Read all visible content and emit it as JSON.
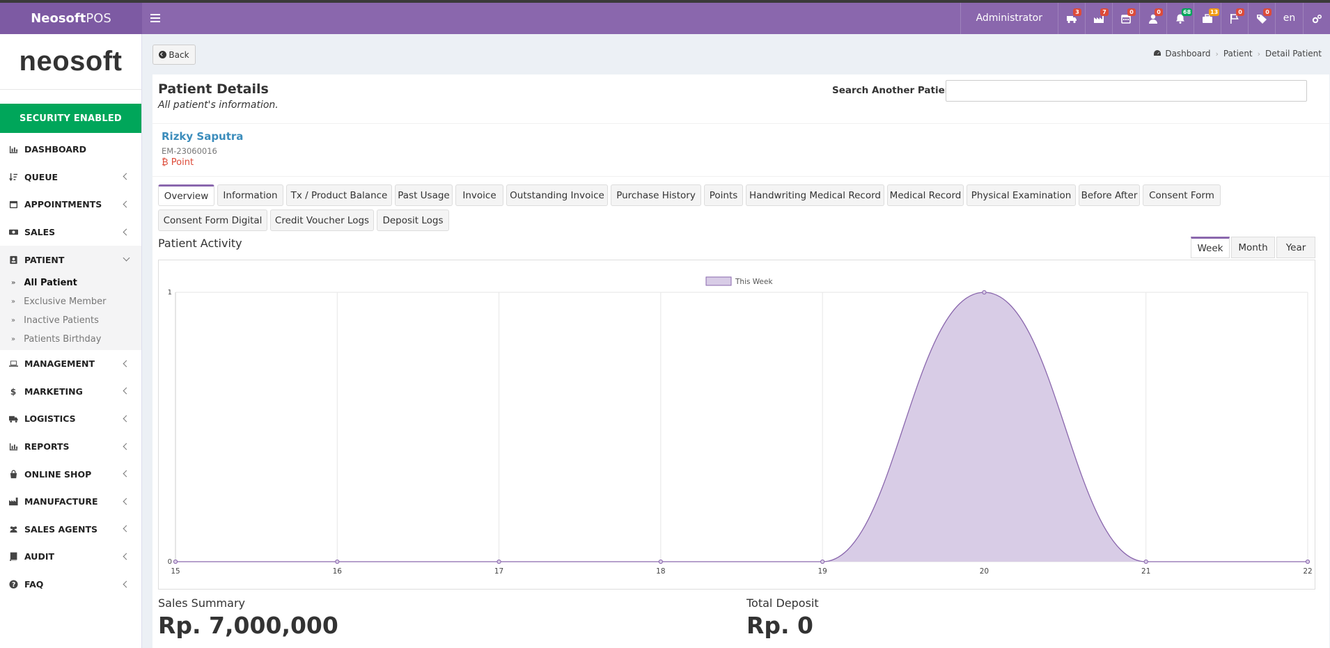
{
  "app": {
    "brand_bold": "Neosoft",
    "brand_light": "POS",
    "logo": "neosoft",
    "security": "SECURITY ENABLED"
  },
  "header": {
    "user": "Administrator",
    "language": "en",
    "icons": [
      {
        "name": "truck-icon",
        "badge": "3",
        "badge_color": "#dd4b39"
      },
      {
        "name": "factory-icon",
        "badge": "7",
        "badge_color": "#dd4b39"
      },
      {
        "name": "calendar-icon",
        "badge": "0",
        "badge_color": "#dd4b39"
      },
      {
        "name": "user-icon",
        "badge": "0",
        "badge_color": "#dd4b39"
      },
      {
        "name": "bell-icon",
        "badge": "68",
        "badge_color": "#00a65a"
      },
      {
        "name": "briefcase-icon",
        "badge": "13",
        "badge_color": "#f39c12"
      },
      {
        "name": "flag-icon",
        "badge": "0",
        "badge_color": "#dd4b39"
      },
      {
        "name": "tag-icon",
        "badge": "0",
        "badge_color": "#dd4b39"
      }
    ]
  },
  "sidebar": {
    "items": [
      {
        "label": "DASHBOARD",
        "icon": "bar-chart-icon",
        "chevron": false
      },
      {
        "label": "QUEUE",
        "icon": "sort-icon",
        "chevron": true
      },
      {
        "label": "APPOINTMENTS",
        "icon": "calendar-icon",
        "chevron": true
      },
      {
        "label": "SALES",
        "icon": "money-icon",
        "chevron": true
      },
      {
        "label": "PATIENT",
        "icon": "id-card-icon",
        "chevron": true,
        "open": true
      },
      {
        "label": "MANAGEMENT",
        "icon": "laptop-icon",
        "chevron": true
      },
      {
        "label": "MARKETING",
        "icon": "dollar-icon",
        "chevron": true
      },
      {
        "label": "LOGISTICS",
        "icon": "truck-icon",
        "chevron": true
      },
      {
        "label": "REPORTS",
        "icon": "bar-chart-icon",
        "chevron": true
      },
      {
        "label": "ONLINE SHOP",
        "icon": "shopping-bag-icon",
        "chevron": true
      },
      {
        "label": "MANUFACTURE",
        "icon": "industry-icon",
        "chevron": true
      },
      {
        "label": "SALES AGENTS",
        "icon": "users-icon",
        "chevron": true
      },
      {
        "label": "AUDIT",
        "icon": "book-icon",
        "chevron": true
      },
      {
        "label": "FAQ",
        "icon": "question-icon",
        "chevron": true
      }
    ],
    "patient_sub": [
      "All Patient",
      "Exclusive Member",
      "Inactive Patients",
      "Patients Birthday"
    ]
  },
  "toolbar": {
    "back": "Back"
  },
  "breadcrumb": [
    "Dashboard",
    "Patient",
    "Detail Patient"
  ],
  "page": {
    "title": "Patient Details",
    "subtitle": "All patient's information.",
    "search_label": "Search Another Patient",
    "search_value": ""
  },
  "patient": {
    "name": "Rizky Saputra",
    "code": "EM-23060016",
    "point": "Point"
  },
  "tabs": [
    "Overview",
    "Information",
    "Tx / Product Balance",
    "Past Usage",
    "Invoice",
    "Outstanding Invoice",
    "Purchase History",
    "Points",
    "Handwriting Medical Record",
    "Medical Record",
    "Physical Examination",
    "Before After",
    "Consent Form",
    "Consent Form Digital",
    "Credit Voucher Logs",
    "Deposit Logs"
  ],
  "activity": {
    "title": "Patient Activity",
    "periods": [
      "Week",
      "Month",
      "Year"
    ]
  },
  "chart_data": {
    "type": "area",
    "title": "",
    "x": [
      "15",
      "16",
      "17",
      "18",
      "19",
      "20",
      "21",
      "22"
    ],
    "series": [
      {
        "name": "This Week",
        "values": [
          0,
          0,
          0,
          0,
          0,
          1,
          0,
          0
        ]
      }
    ],
    "ylim": [
      0,
      1
    ],
    "yticks": [
      "0",
      "1"
    ],
    "grid": true,
    "legend": "top-center",
    "colors": {
      "fill": "#d8cce6",
      "line": "#8a67ad"
    }
  },
  "summary": {
    "sales_label": "Sales Summary",
    "sales_value": "Rp. 7,000,000",
    "deposit_label": "Total Deposit",
    "deposit_value": "Rp. 0"
  }
}
